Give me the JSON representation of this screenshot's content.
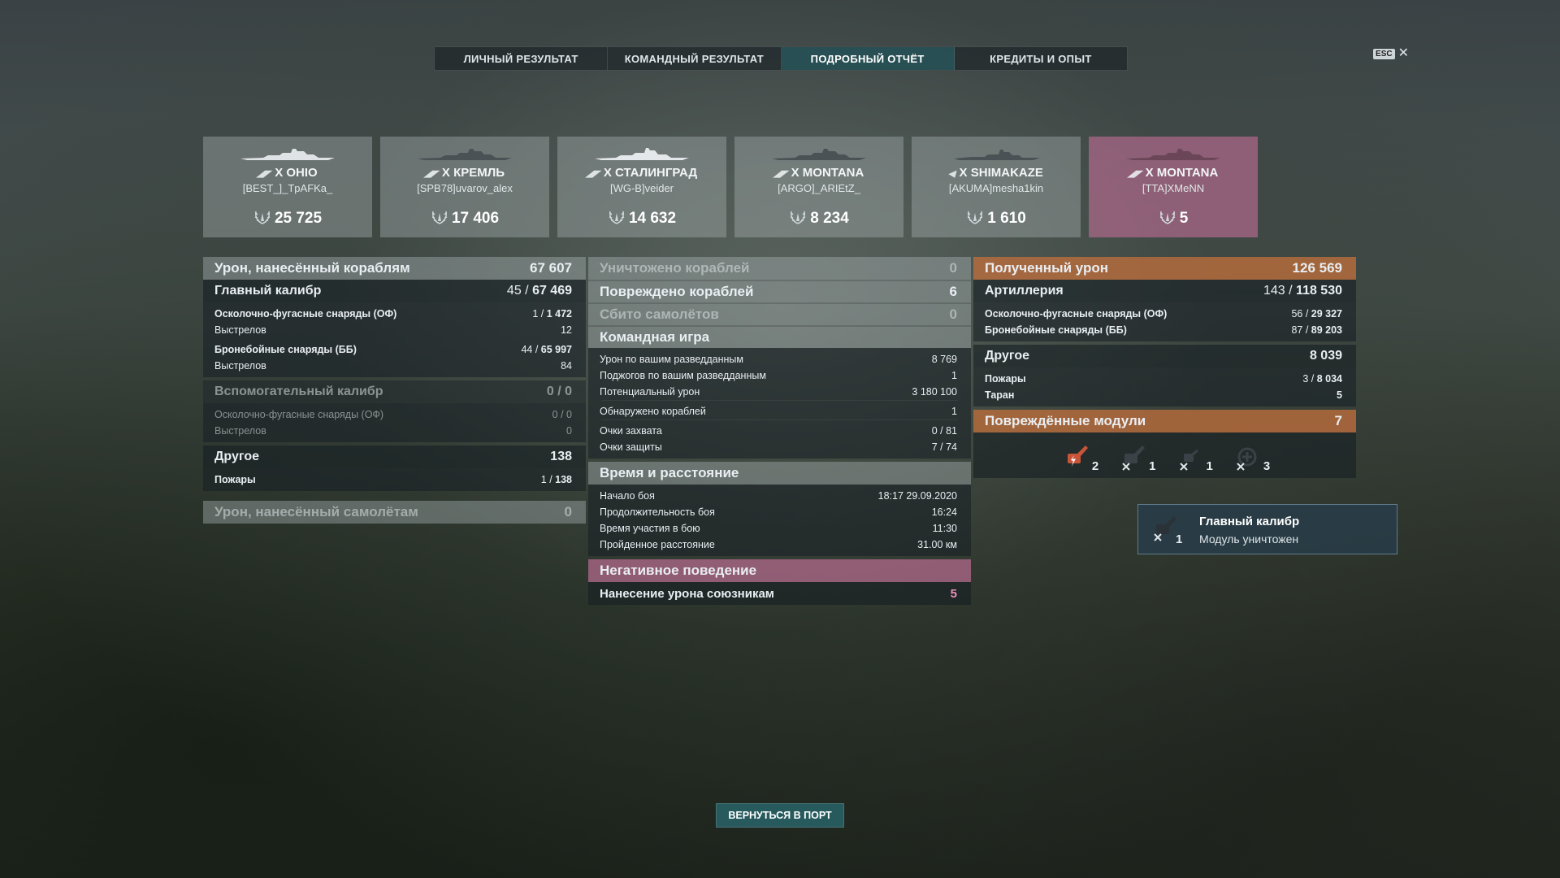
{
  "tabs": [
    {
      "label": "ЛИЧНЫЙ РЕЗУЛЬТАТ"
    },
    {
      "label": "КОМАНДНЫЙ РЕЗУЛЬТАТ"
    },
    {
      "label": "ПОДРОБНЫЙ ОТЧЁТ"
    },
    {
      "label": "КРЕДИТЫ И ОПЫТ"
    }
  ],
  "active_tab": "ПОДРОБНЫЙ ОТЧЁТ",
  "esc": {
    "key": "ESC",
    "close": "✕"
  },
  "players": [
    {
      "tier": "X",
      "ship": "OHIO",
      "player": "[BEST_]_TpAFKa_",
      "score": "25 725",
      "icon": "battleship-icon",
      "highlight": false
    },
    {
      "tier": "X",
      "ship": "КРЕМЛЬ",
      "player": "[SPB78]uvarov_alex",
      "score": "17 406",
      "icon": "battleship-icon",
      "highlight": false
    },
    {
      "tier": "X",
      "ship": "СТАЛИНГРАД",
      "player": "[WG-B]veider",
      "score": "14 632",
      "icon": "cruiser-icon",
      "highlight": false
    },
    {
      "tier": "X",
      "ship": "MONTANA",
      "player": "[ARGO]_ARIEtZ_",
      "score": "8 234",
      "icon": "battleship-icon",
      "highlight": false
    },
    {
      "tier": "X",
      "ship": "SHIMAKAZE",
      "player": "[AKUMA]mesha1kin",
      "score": "1 610",
      "icon": "destroyer-icon",
      "highlight": false
    },
    {
      "tier": "X",
      "ship": "MONTANA",
      "player": "[TTA]XMeNN",
      "score": "5",
      "icon": "battleship-icon",
      "highlight": true
    }
  ],
  "left": {
    "damage_ships": {
      "label": "Урон, нанесённый кораблям",
      "value": "67 607"
    },
    "main_battery": {
      "label": "Главный калибр",
      "hits": "45",
      "value": "67 469"
    },
    "he": {
      "label": "Осколочно-фугасные снаряды (ОФ)",
      "hits": "1",
      "value": "1 472"
    },
    "he_shots": {
      "label": "Выстрелов",
      "value": "12"
    },
    "ap": {
      "label": "Бронебойные снаряды (ББ)",
      "hits": "44",
      "value": "65 997"
    },
    "ap_shots": {
      "label": "Выстрелов",
      "value": "84"
    },
    "secondary": {
      "label": "Вспомогательный калибр",
      "value": "0 / 0"
    },
    "sec_he": {
      "label": "Осколочно-фугасные снаряды (ОФ)",
      "value": "0 / 0"
    },
    "sec_shots": {
      "label": "Выстрелов",
      "value": "0"
    },
    "other": {
      "label": "Другое",
      "value": "138"
    },
    "fires": {
      "label": "Пожары",
      "hits": "1",
      "value": "138"
    },
    "damage_planes": {
      "label": "Урон, нанесённый самолётам",
      "value": "0"
    }
  },
  "middle": {
    "destroyed": {
      "label": "Уничтожено кораблей",
      "value": "0"
    },
    "damaged": {
      "label": "Повреждено кораблей",
      "value": "6"
    },
    "planes": {
      "label": "Сбито самолётов",
      "value": "0"
    },
    "teamplay": {
      "label": "Командная игра"
    },
    "spot_dmg": {
      "label": "Урон по вашим разведданным",
      "value": "8 769"
    },
    "spot_fires": {
      "label": "Поджогов по вашим разведданным",
      "value": "1"
    },
    "potential": {
      "label": "Потенциальный урон",
      "value": "3 180 100"
    },
    "spotted": {
      "label": "Обнаружено кораблей",
      "value": "1"
    },
    "capture": {
      "label": "Очки захвата",
      "value": "0 / 81"
    },
    "defense": {
      "label": "Очки защиты",
      "value": "7 / 74"
    },
    "time": {
      "label": "Время и расстояние"
    },
    "start": {
      "label": "Начало боя",
      "value": "18:17  29.09.2020"
    },
    "duration": {
      "label": "Продолжительность боя",
      "value": "16:24"
    },
    "participation": {
      "label": "Время участия в бою",
      "value": "11:30"
    },
    "distance": {
      "label": "Пройденное расстояние",
      "value": "31.00 км"
    },
    "negative": {
      "label": "Негативное поведение"
    },
    "team_damage": {
      "label": "Нанесение урона союзникам",
      "value": "5"
    }
  },
  "right": {
    "received": {
      "label": "Полученный урон",
      "value": "126 569"
    },
    "artillery": {
      "label": "Артиллерия",
      "hits": "143",
      "value": "118 530"
    },
    "he": {
      "label": "Осколочно-фугасные снаряды (ОФ)",
      "hits": "56",
      "value": "29 327"
    },
    "ap": {
      "label": "Бронебойные снаряды (ББ)",
      "hits": "87",
      "value": "89 203"
    },
    "other": {
      "label": "Другое",
      "value": "8 039"
    },
    "fires": {
      "label": "Пожары",
      "hits": "3",
      "value": "8 034"
    },
    "ram": {
      "label": "Таран",
      "value": "5"
    },
    "modules": {
      "label": "Повреждённые модули",
      "value": "7"
    },
    "module_items": [
      {
        "icon": "main-battery-damaged-icon",
        "count": "2"
      },
      {
        "icon": "main-battery-destroyed-icon",
        "count": "1"
      },
      {
        "icon": "secondary-destroyed-icon",
        "count": "1"
      },
      {
        "icon": "aa-destroyed-icon",
        "count": "3"
      }
    ]
  },
  "tooltip": {
    "title": "Главный калибр",
    "subtitle": "Модуль уничтожен",
    "count": "1"
  },
  "return_button": "ВЕРНУТЬСЯ В ПОРТ"
}
